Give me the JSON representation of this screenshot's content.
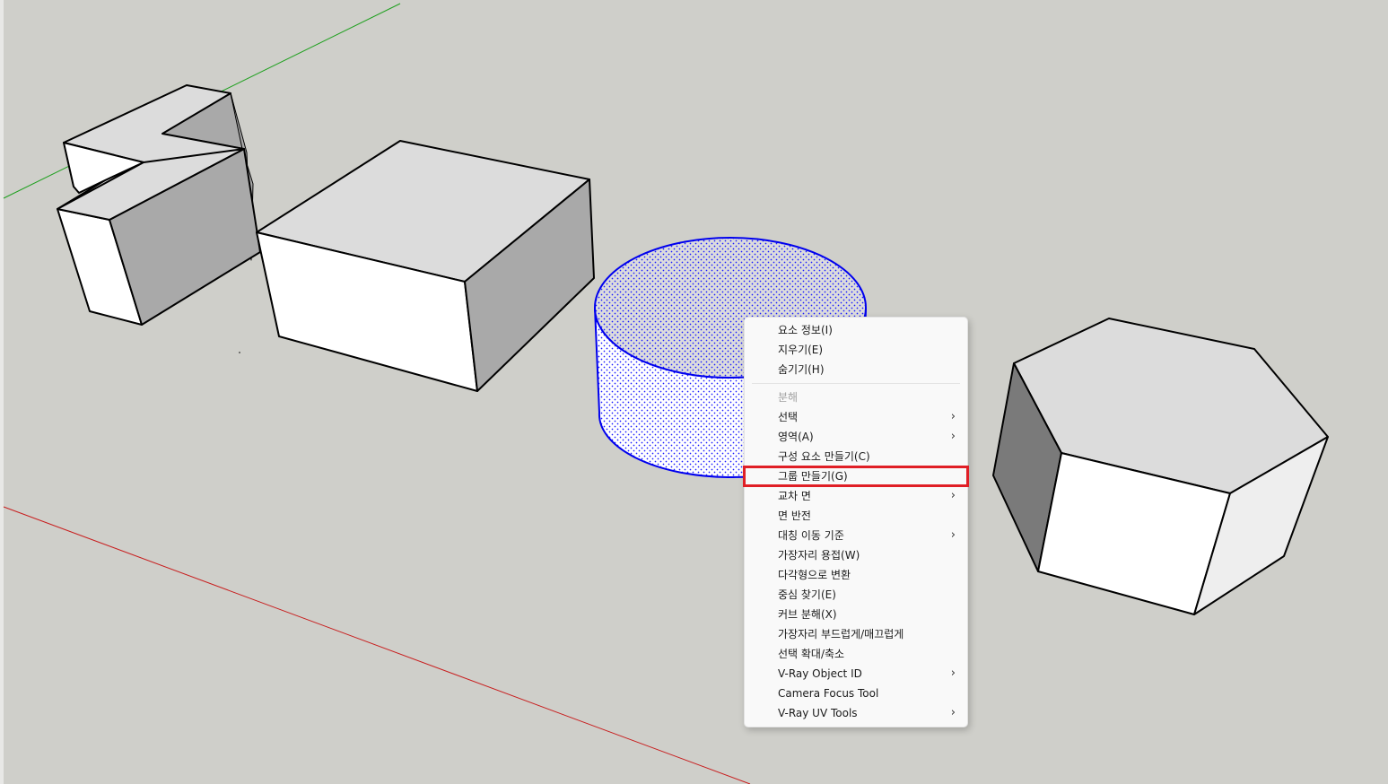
{
  "context_menu": {
    "items": [
      {
        "label": "요소 정보(I)",
        "disabled": false,
        "submenu": false
      },
      {
        "label": "지우기(E)",
        "disabled": false,
        "submenu": false
      },
      {
        "label": "숨기기(H)",
        "disabled": false,
        "submenu": false
      },
      {
        "separator": true
      },
      {
        "label": "분해",
        "disabled": true,
        "submenu": false
      },
      {
        "label": "선택",
        "disabled": false,
        "submenu": true
      },
      {
        "label": "영역(A)",
        "disabled": false,
        "submenu": true
      },
      {
        "label": "구성 요소 만들기(C)",
        "disabled": false,
        "submenu": false
      },
      {
        "label": "그룹 만들기(G)",
        "disabled": false,
        "submenu": false,
        "highlighted": true
      },
      {
        "label": "교차 면",
        "disabled": false,
        "submenu": true
      },
      {
        "label": "면 반전",
        "disabled": false,
        "submenu": false
      },
      {
        "label": "대칭 이동 기준",
        "disabled": false,
        "submenu": true
      },
      {
        "label": "가장자리 용접(W)",
        "disabled": false,
        "submenu": false
      },
      {
        "label": "다각형으로 변환",
        "disabled": false,
        "submenu": false
      },
      {
        "label": "중심 찾기(E)",
        "disabled": false,
        "submenu": false
      },
      {
        "label": "커브 분해(X)",
        "disabled": false,
        "submenu": false
      },
      {
        "label": "가장자리 부드럽게/매끄럽게",
        "disabled": false,
        "submenu": false
      },
      {
        "label": "선택 확대/축소",
        "disabled": false,
        "submenu": false
      },
      {
        "label": "V-Ray Object ID",
        "disabled": false,
        "submenu": true
      },
      {
        "label": "Camera Focus Tool",
        "disabled": false,
        "submenu": false
      },
      {
        "label": "V-Ray UV Tools",
        "disabled": false,
        "submenu": true
      }
    ],
    "submenu_arrow": "›",
    "highlight_color": "#e01f26"
  },
  "scene": {
    "background_color": "#cfcfca",
    "green_axis_color": "#1fa01f",
    "red_axis_color": "#c81e1e",
    "selection_color": "#0000ee",
    "face_top_color": "#dcdcdc",
    "face_front_color": "#ffffff",
    "face_side_color": "#a9a9a9"
  }
}
